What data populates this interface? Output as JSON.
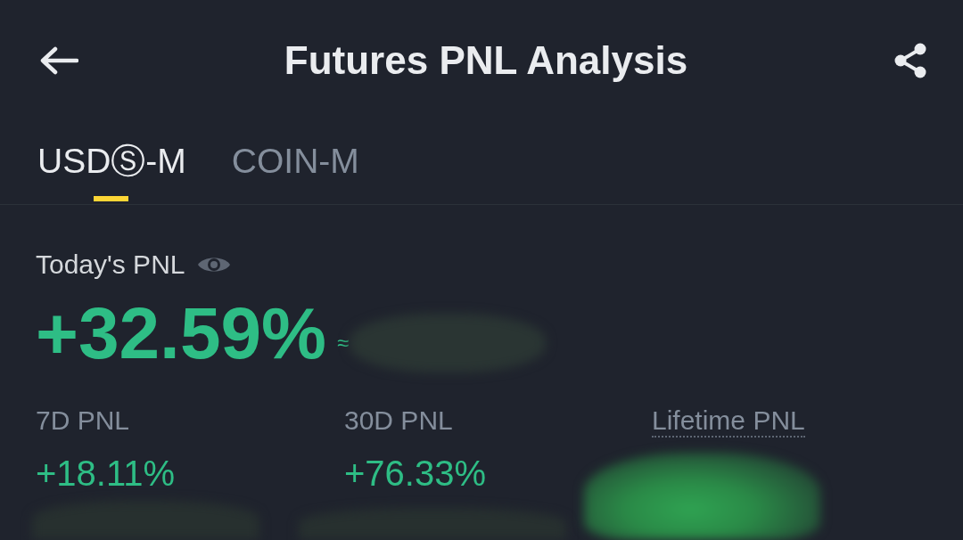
{
  "header": {
    "title": "Futures PNL Analysis"
  },
  "tabs": [
    {
      "label": "USDⓈ-M",
      "selected": true
    },
    {
      "label": "COIN-M",
      "selected": false
    }
  ],
  "today": {
    "label": "Today's PNL",
    "value": "+32.59%",
    "approx": "≈"
  },
  "periods": [
    {
      "label": "7D PNL",
      "value": "+18.11%",
      "dotted_underline": false
    },
    {
      "label": "30D PNL",
      "value": "+76.33%",
      "dotted_underline": false
    },
    {
      "label": "Lifetime PNL",
      "dotted_underline": true
    }
  ]
}
